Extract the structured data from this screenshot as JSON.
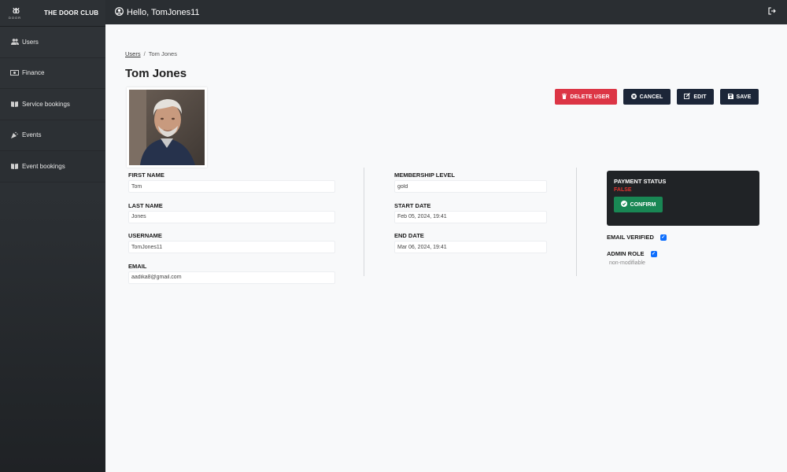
{
  "brand": {
    "name": "THE DOOR CLUB",
    "logo_text": "DOOR"
  },
  "sidebar": {
    "items": [
      {
        "label": "Users",
        "icon": "users-icon"
      },
      {
        "label": "Finance",
        "icon": "money-icon"
      },
      {
        "label": "Service bookings",
        "icon": "book-icon"
      },
      {
        "label": "Events",
        "icon": "party-icon"
      },
      {
        "label": "Event bookings",
        "icon": "book-icon"
      }
    ]
  },
  "topbar": {
    "greeting": "Hello, TomJones11"
  },
  "breadcrumb": {
    "parent": "Users",
    "separator": "/",
    "current": "Tom Jones"
  },
  "page": {
    "title": "Tom Jones"
  },
  "actions": {
    "delete_label": "DELETE USER",
    "cancel_label": "CANCEL",
    "edit_label": "EDIT",
    "save_label": "SAVE"
  },
  "fields": {
    "first_name": {
      "label": "FIRST NAME",
      "value": "Tom"
    },
    "last_name": {
      "label": "LAST NAME",
      "value": "Jones"
    },
    "username": {
      "label": "USERNAME",
      "value": "TomJones11"
    },
    "email": {
      "label": "EMAIL",
      "value": "aadika8@gmail.com"
    },
    "membership_level": {
      "label": "MEMBERSHIP LEVEL",
      "value": "gold"
    },
    "start_date": {
      "label": "START DATE",
      "value": "Feb 05, 2024, 19:41"
    },
    "end_date": {
      "label": "END DATE",
      "value": "Mar 06, 2024, 19:41"
    }
  },
  "payment": {
    "title": "PAYMENT STATUS",
    "value": "FALSE",
    "confirm_label": "CONFIRM"
  },
  "flags": {
    "email_verified": {
      "label": "EMAIL VERIFIED",
      "checked": true
    },
    "admin_role": {
      "label": "ADMIN ROLE",
      "checked": true,
      "hint": "non-modifiable"
    }
  },
  "colors": {
    "sidebar_bg": "#2d3135",
    "topbar_bg": "#2a2e32",
    "danger": "#dc3545",
    "primary_dark": "#1c2638",
    "success": "#198754",
    "checkbox": "#0d6efd",
    "payment_false": "#e3342f"
  }
}
